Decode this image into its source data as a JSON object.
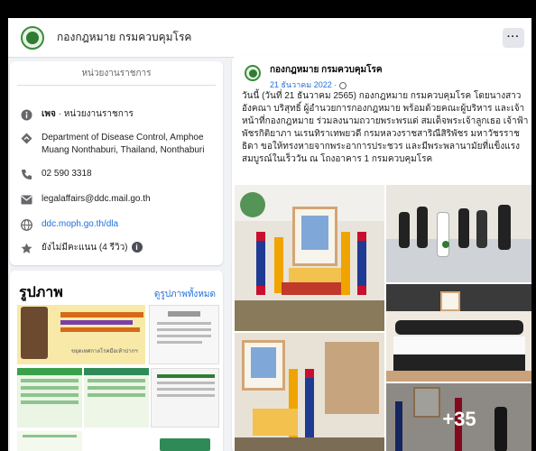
{
  "header": {
    "title": "กองกฎหมาย กรมควบคุมโรค",
    "more_label": "···"
  },
  "intro": {
    "category_header": "หน่วยงานราชการ",
    "page_type_bold": "เพจ",
    "page_type_rest": " · หน่วยงานราชการ",
    "address": "Department of Disease Control, Amphoe Muang Nonthaburi, Thailand, Nonthaburi",
    "phone": "02 590 3318",
    "email": "legalaffairs@ddc.mail.go.th",
    "website": "ddc.moph.go.th/dla",
    "rating": "ยังไม่มีคะแนน (4 รีวิว)",
    "rating_info": "i"
  },
  "photos": {
    "title": "รูปภาพ",
    "see_all": "ดูรูปภาพทั้งหมด",
    "thumb1_text": "ขยุดเทศกาลโรคมือเท้าปากฯ",
    "thumb2_text": "ข้อประกาศ"
  },
  "post": {
    "author": "กองกฎหมาย กรมควบคุมโรค",
    "date": "21 ธันวาคม 2022 ·",
    "body": "วันนี้ (วันที่ 21 ธันวาคม 2565) กองกฎหมาย กรมควบคุมโรค โดยนางสาวอังคณา บริสุทธิ์ ผู้อำนวยการกองกฎหมาย พร้อมด้วยคณะผู้บริหาร และเจ้าหน้าที่กองกฎหมาย ร่วมลงนามถวายพระพรแด่ สมเด็จพระเจ้าลูกเธอ เจ้าฟ้าพัชรกิติยาภา นเรนทิราเทพยวดี กรมหลวงราชสาริณีสิริพัชร มหาวัชรราชธิดา ขอให้ทรงหายจากพระอาการประชวร และมีพระพลานามัยที่แข็งแรงสมบูรณ์ในเร็ววัน ณ โถงอาคาร 1 กรมควบคุมโรค",
    "more_count": "+35"
  },
  "colors": {
    "link": "#216fdb",
    "brand_green": "#2e7d32",
    "thai_red": "#c8102e",
    "thai_blue": "#1f3a93"
  }
}
